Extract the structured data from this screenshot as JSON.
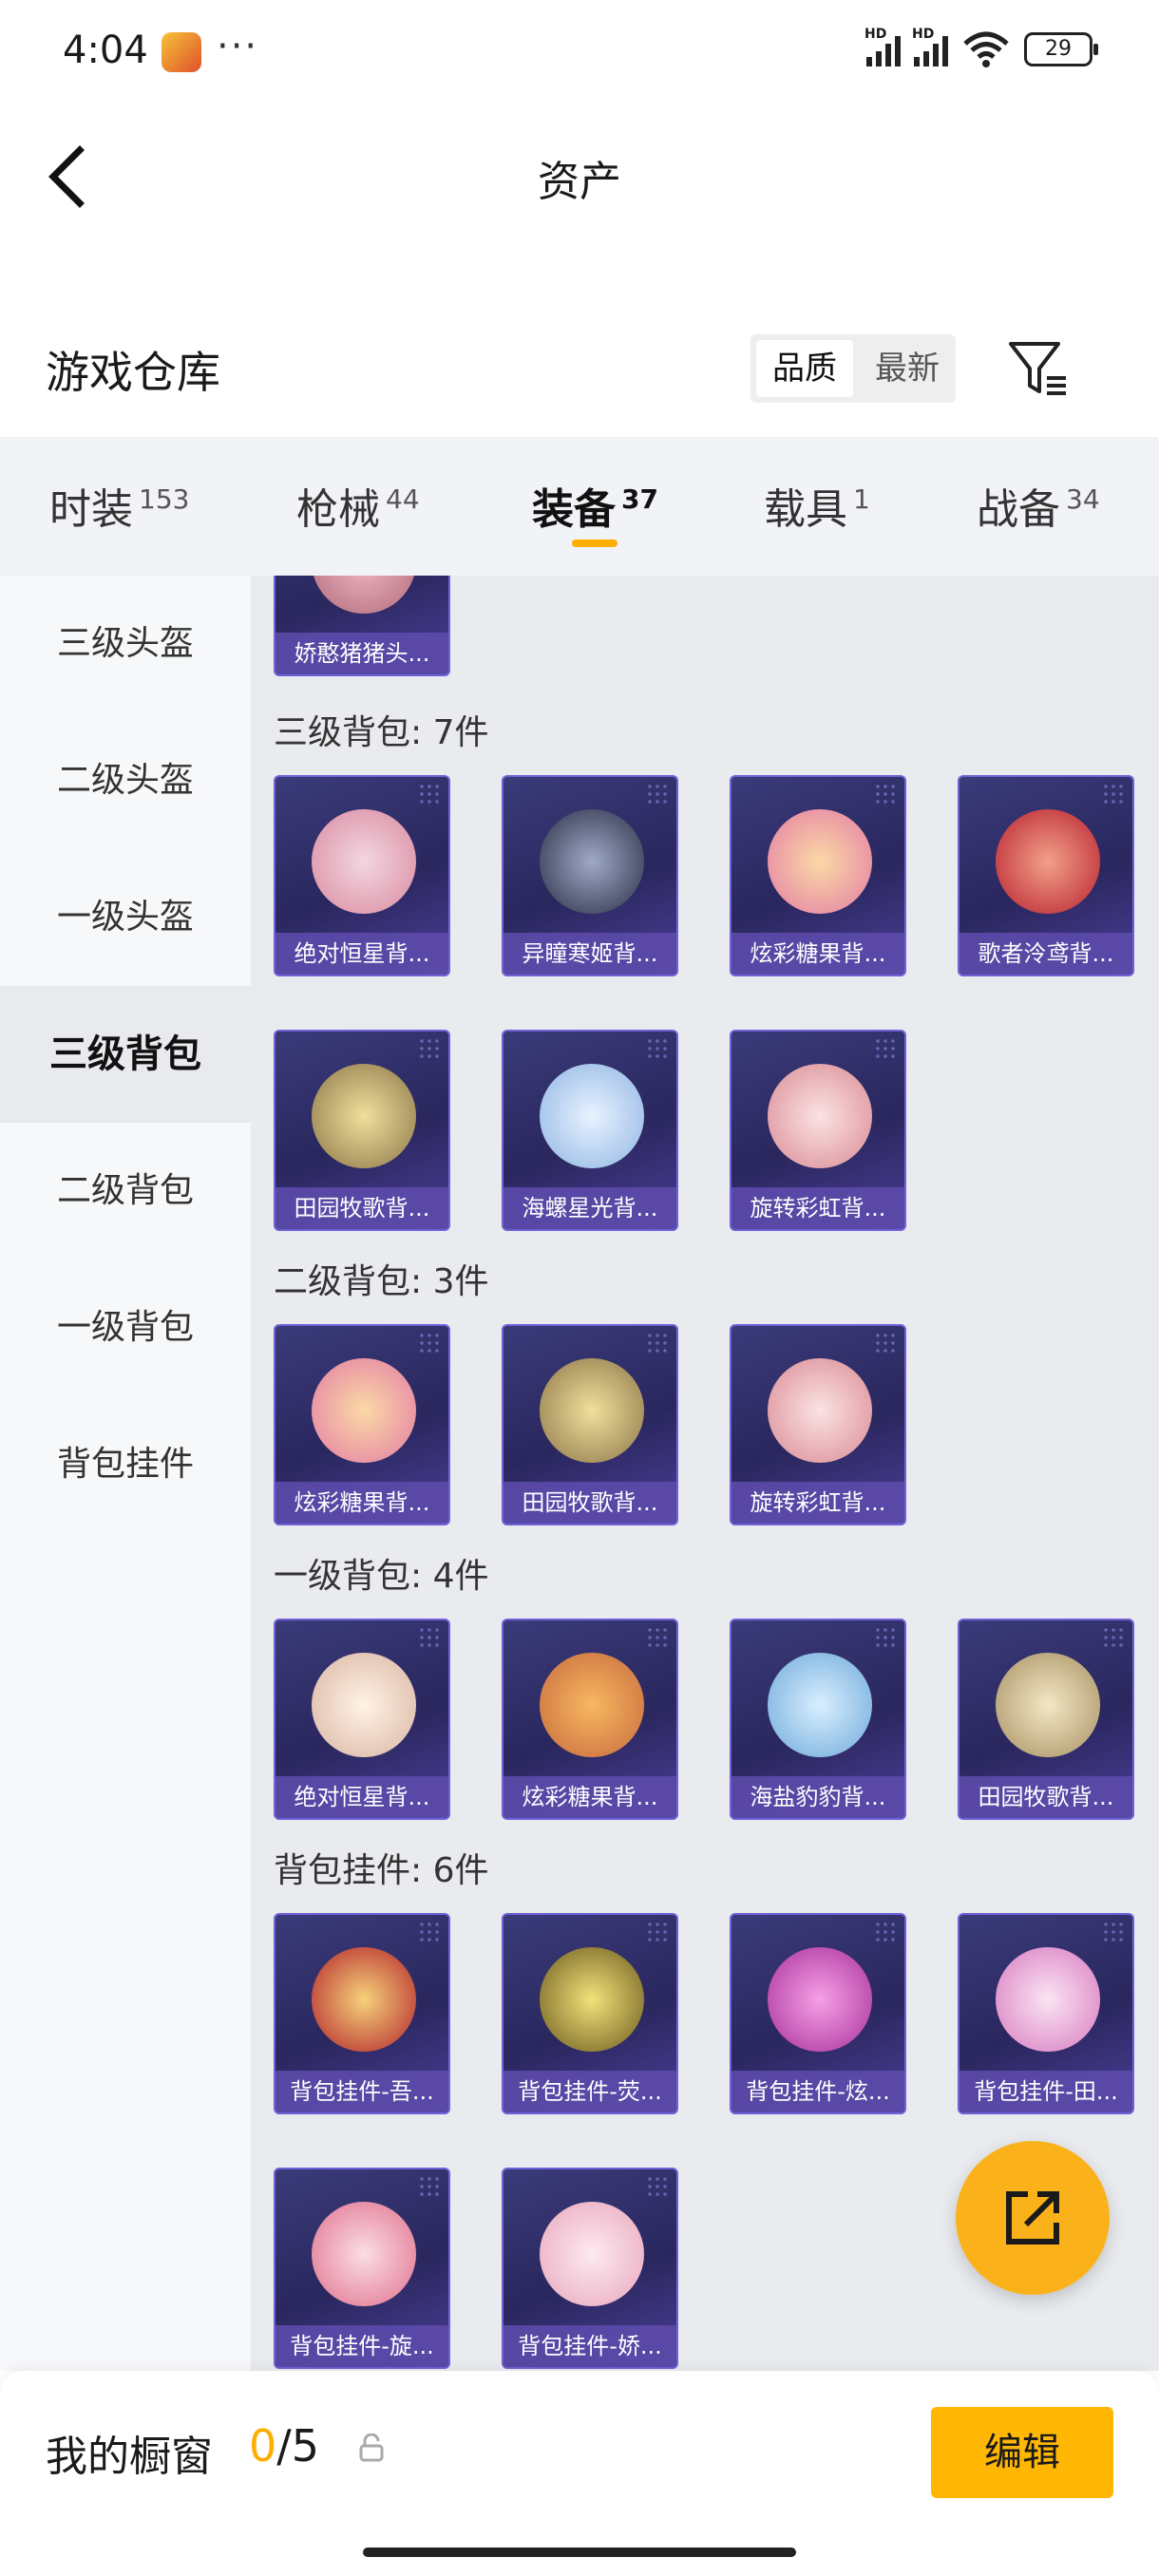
{
  "status_bar": {
    "time": "4:04",
    "dots": "···",
    "network_1": "HD",
    "network_2": "HD",
    "battery": "29"
  },
  "header": {
    "title": "资产"
  },
  "warehouse": {
    "title": "游戏仓库",
    "sort_options": [
      "品质",
      "最新"
    ],
    "active_sort": "品质"
  },
  "tabs": [
    {
      "label": "时装",
      "count": "153"
    },
    {
      "label": "枪械",
      "count": "44"
    },
    {
      "label": "装备",
      "count": "37"
    },
    {
      "label": "载具",
      "count": "1"
    },
    {
      "label": "战备",
      "count": "34"
    }
  ],
  "active_tab": "装备",
  "sidebar": [
    {
      "label": "三级头盔"
    },
    {
      "label": "二级头盔"
    },
    {
      "label": "一级头盔"
    },
    {
      "label": "三级背包"
    },
    {
      "label": "二级背包"
    },
    {
      "label": "一级背包"
    },
    {
      "label": "背包挂件"
    }
  ],
  "active_sidebar": "三级背包",
  "top_partial_item": {
    "name": "娇憨猪猪头..."
  },
  "sections": [
    {
      "title": "三级背包: 7件",
      "items": [
        "绝对恒星背...",
        "异瞳寒姬背...",
        "炫彩糖果背...",
        "歌者泠鸢背...",
        "田园牧歌背...",
        "海螺星光背...",
        "旋转彩虹背..."
      ]
    },
    {
      "title": "二级背包: 3件",
      "items": [
        "炫彩糖果背...",
        "田园牧歌背...",
        "旋转彩虹背..."
      ]
    },
    {
      "title": "一级背包: 4件",
      "items": [
        "绝对恒星背...",
        "炫彩糖果背...",
        "海盐豹豹背...",
        "田园牧歌背..."
      ]
    },
    {
      "title": "背包挂件: 6件",
      "items": [
        "背包挂件-吾...",
        "背包挂件-荧...",
        "背包挂件-炫...",
        "背包挂件-田...",
        "背包挂件-旋...",
        "背包挂件-娇..."
      ]
    }
  ],
  "bottom_bar": {
    "label": "我的橱窗",
    "count_current": "0",
    "count_sep_total": "/5",
    "edit_label": "编辑"
  },
  "colors": {
    "accent": "#ffb703",
    "card_bg": "#2a275e",
    "card_border": "#6e62d6"
  }
}
